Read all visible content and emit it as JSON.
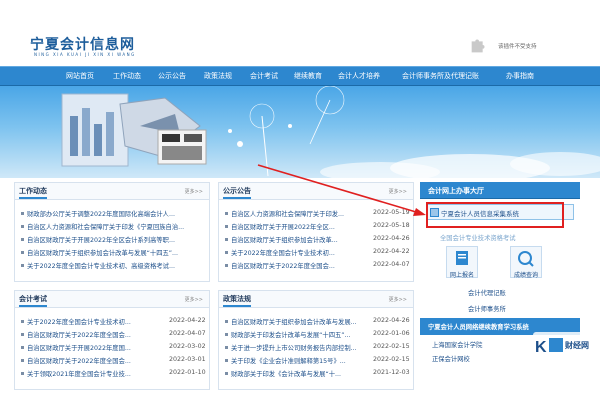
{
  "header": {
    "title": "宁夏会计信息网",
    "subtitle": "NING XIA KUAI JI XIN XI WANG",
    "plugin_text": "该插件不受支持"
  },
  "nav": {
    "items": [
      "网站首页",
      "工作动态",
      "公示公告",
      "政策法规",
      "会计考试",
      "继续教育",
      "会计人才培养",
      "会计师事务所及代理记账",
      "办事指南"
    ]
  },
  "colors": {
    "nav_bg": "#2d87cf",
    "link": "#1d4f8a",
    "highlight": "#e02020"
  },
  "panels": {
    "work": {
      "title": "工作动态",
      "more": "更多>>",
      "rows": [
        {
          "text": "财政部办公厅关于调整2022年度国际化高端会计人..."
        },
        {
          "text": "自治区人力资源和社会保障厅关于印发《宁夏回族自治..."
        },
        {
          "text": "自治区财政厅关于开展2022年全区会计系列高等职..."
        },
        {
          "text": "自治区财政厅关于组织参加会计改革与发展“十四五”..."
        },
        {
          "text": "关于2022年度全国会计专业技术初、高级资格考试..."
        }
      ]
    },
    "notice": {
      "title": "公示公告",
      "more": "更多>>",
      "rows": [
        {
          "text": "自治区人力资源和社会保障厅关于印发...",
          "date": "2022-05-19"
        },
        {
          "text": "自治区财政厅关于开展2022年全区...",
          "date": "2022-05-18"
        },
        {
          "text": "自治区财政厅关于组织参加会计改革...",
          "date": "2022-04-26"
        },
        {
          "text": "关于2022年度全国会计专业技术初...",
          "date": "2022-04-22"
        },
        {
          "text": "自治区财政厅关于2022年度全国会...",
          "date": "2022-04-07"
        }
      ]
    },
    "exam": {
      "title": "会计考试",
      "more": "更多>>",
      "rows": [
        {
          "text": "关于2022年度全国会计专业技术初...",
          "date": "2022-04-22"
        },
        {
          "text": "自治区财政厅关于2022年度全国会...",
          "date": "2022-04-07"
        },
        {
          "text": "自治区财政厅关于开展2022年度国...",
          "date": "2022-03-02"
        },
        {
          "text": "自治区财政厅关于2022年度全国会...",
          "date": "2022-03-01"
        },
        {
          "text": "关于领取2021年度全国会计专业技...",
          "date": "2022-01-10"
        }
      ]
    },
    "policy": {
      "title": "政策法规",
      "more": "更多>>",
      "rows": [
        {
          "text": "自治区财政厅关于组织参加会计改革与发展...",
          "date": "2022-04-26"
        },
        {
          "text": "财政部关于印发会计改革与发展“十四五”...",
          "date": "2022-01-06"
        },
        {
          "text": "关于进一步提升上市公司财务报告内部控制...",
          "date": "2022-02-15"
        },
        {
          "text": "关于印发《企业会计准则解释第15号》...",
          "date": "2022-02-15"
        },
        {
          "text": "财政部关于印发《会计改革与发展“十...",
          "date": "2021-12-03"
        }
      ]
    }
  },
  "right": {
    "head": "会计网上办事大厅",
    "highlight": "宁夏会计人员信息采集系统",
    "exam_link": "全国会计专业技术资格考试",
    "tile1": "网上报名",
    "tile2": "成绩查询",
    "link_a": "会计代理记账",
    "link_b": "会计师事务所",
    "bar2": "宁夏会计人员网络继续教育学习系统",
    "link_c": "上海国家会计学院",
    "link_d": "正保会计网校",
    "watermark": "财经网"
  }
}
